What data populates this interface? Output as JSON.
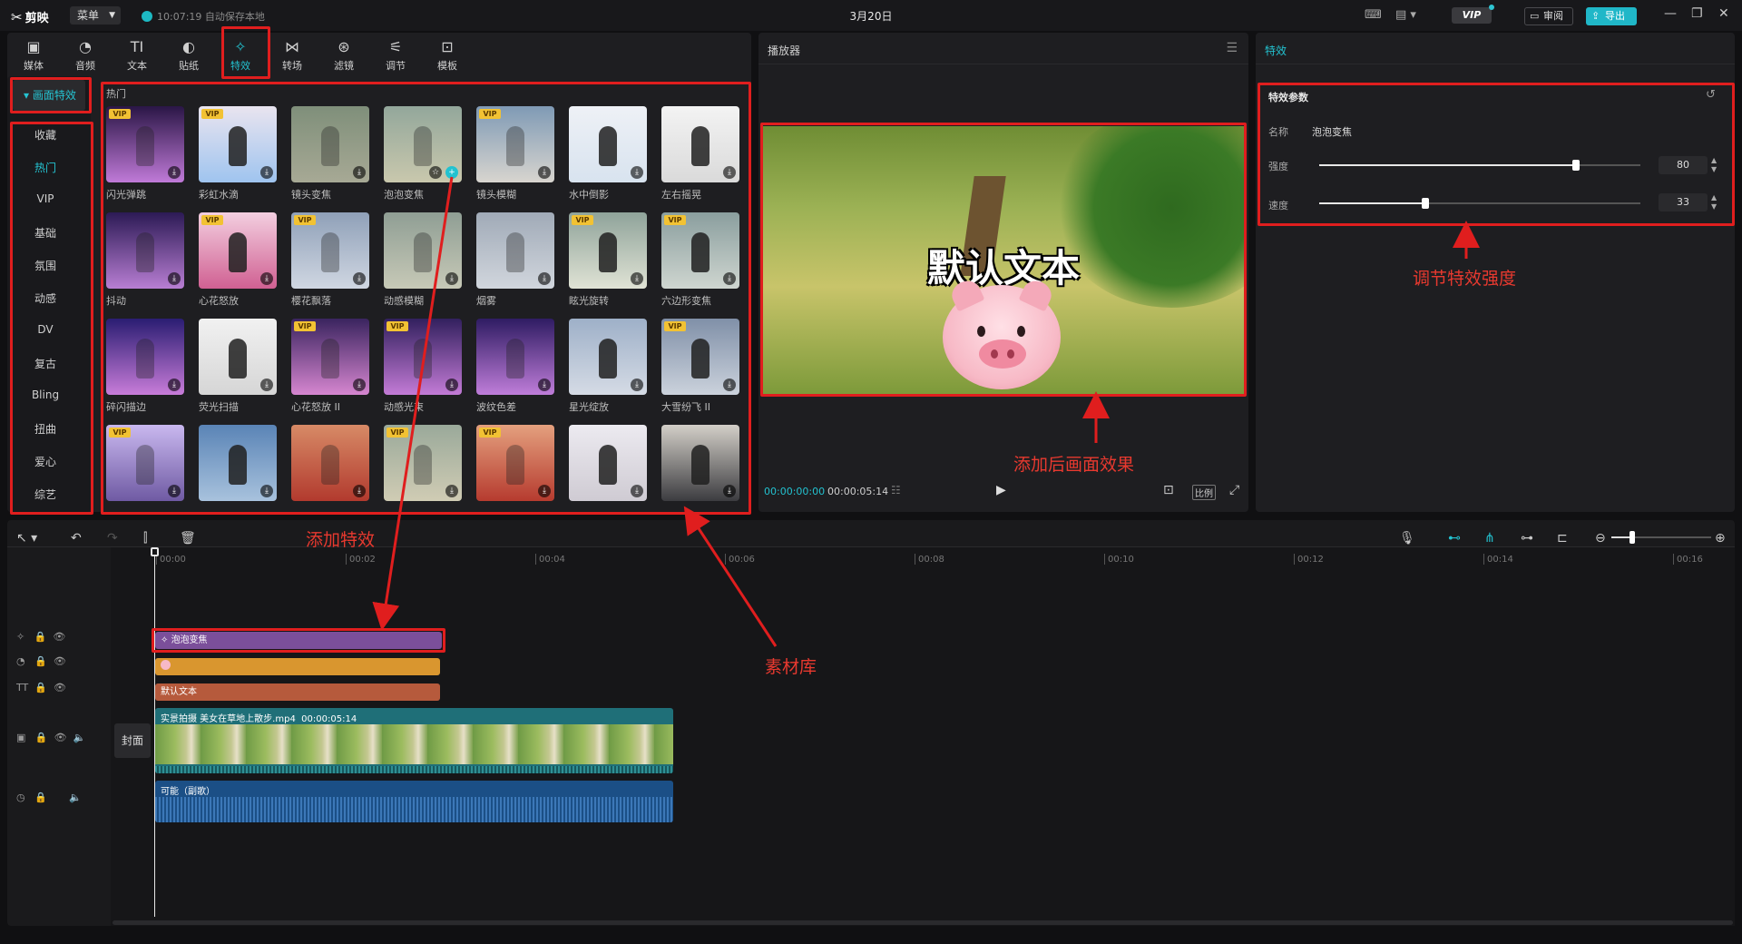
{
  "titlebar": {
    "app_name": "剪映",
    "menu_label": "菜单",
    "autosave_text": "10:07:19 自动保存本地",
    "project_title": "3月20日",
    "vip_label": "VIP",
    "review_label": "审阅",
    "export_label": "导出"
  },
  "toolbar": [
    {
      "label": "媒体",
      "icon": "media-icon",
      "glyph": "▣"
    },
    {
      "label": "音频",
      "icon": "audio-icon",
      "glyph": "◔"
    },
    {
      "label": "文本",
      "icon": "text-icon",
      "glyph": "TI"
    },
    {
      "label": "贴纸",
      "icon": "sticker-icon",
      "glyph": "◐"
    },
    {
      "label": "特效",
      "icon": "effects-icon",
      "glyph": "✧"
    },
    {
      "label": "转场",
      "icon": "transition-icon",
      "glyph": "⋈"
    },
    {
      "label": "滤镜",
      "icon": "filter-icon",
      "glyph": "⊛"
    },
    {
      "label": "调节",
      "icon": "adjust-icon",
      "glyph": "⚟"
    },
    {
      "label": "模板",
      "icon": "template-icon",
      "glyph": "⊡"
    }
  ],
  "categories": {
    "top_label": "▾ 画面特效",
    "items": [
      "收藏",
      "热门",
      "VIP",
      "基础",
      "氛围",
      "动感",
      "DV",
      "复古",
      "Bling",
      "扭曲",
      "爱心",
      "综艺"
    ],
    "active": "热门"
  },
  "effects_grid": {
    "section_title": "热门",
    "rows": [
      [
        {
          "name": "闪光弹跳",
          "vip": true,
          "colors": [
            "#2a1646",
            "#c07ad8"
          ]
        },
        {
          "name": "彩虹水滴",
          "vip": true,
          "colors": [
            "#e9e4ef",
            "#9fc4ef"
          ]
        },
        {
          "name": "镜头变焦",
          "vip": false,
          "colors": [
            "#7f8f7a",
            "#a7a995"
          ]
        },
        {
          "name": "泡泡变焦",
          "vip": false,
          "colors": [
            "#93a79b",
            "#c9c8ad"
          ]
        },
        {
          "name": "镜头模糊",
          "vip": true,
          "colors": [
            "#7f9ab5",
            "#d8d5cf"
          ]
        },
        {
          "name": "水中倒影",
          "vip": false,
          "colors": [
            "#eef1f6",
            "#d8e3ef"
          ]
        },
        {
          "name": "左右摇晃",
          "vip": false,
          "colors": [
            "#f3f3f3",
            "#dadada"
          ]
        }
      ],
      [
        {
          "name": "抖动",
          "vip": false,
          "colors": [
            "#2c1a55",
            "#b87ed3"
          ]
        },
        {
          "name": "心花怒放",
          "vip": true,
          "colors": [
            "#f3cfe0",
            "#d06092"
          ]
        },
        {
          "name": "樱花飘落",
          "vip": true,
          "colors": [
            "#8fa0b8",
            "#d0d7e2"
          ]
        },
        {
          "name": "动感模糊",
          "vip": false,
          "colors": [
            "#8f9e94",
            "#c7c9b7"
          ]
        },
        {
          "name": "烟雾",
          "vip": false,
          "colors": [
            "#a0aab7",
            "#d1d6dd"
          ]
        },
        {
          "name": "眩光旋转",
          "vip": true,
          "colors": [
            "#8fa39a",
            "#e0e3d5"
          ]
        },
        {
          "name": "六边形变焦",
          "vip": true,
          "colors": [
            "#8a9e9e",
            "#cfd6d0"
          ]
        }
      ],
      [
        {
          "name": "碎闪描边",
          "vip": false,
          "colors": [
            "#2a1d72",
            "#c87cd9"
          ]
        },
        {
          "name": "荧光扫描",
          "vip": false,
          "colors": [
            "#f1f1f1",
            "#d6d6d6"
          ]
        },
        {
          "name": "心花怒放 II",
          "vip": true,
          "colors": [
            "#3a245f",
            "#d686d0"
          ]
        },
        {
          "name": "动感光束",
          "vip": true,
          "colors": [
            "#32205e",
            "#c37bd6"
          ]
        },
        {
          "name": "波纹色差",
          "vip": false,
          "colors": [
            "#2f1c63",
            "#bf7dd9"
          ]
        },
        {
          "name": "星光绽放",
          "vip": false,
          "colors": [
            "#9eb0c8",
            "#d5dbe5"
          ]
        },
        {
          "name": "大雪纷飞 II",
          "vip": true,
          "colors": [
            "#8090a8",
            "#cbd2dc"
          ]
        }
      ],
      [
        {
          "name": "",
          "vip": true,
          "colors": [
            "#c9b8ef",
            "#6f5aa3"
          ]
        },
        {
          "name": "",
          "vip": false,
          "colors": [
            "#5a84b6",
            "#a8c2dd"
          ]
        },
        {
          "name": "",
          "vip": false,
          "colors": [
            "#d78a66",
            "#b23a2e"
          ]
        },
        {
          "name": "",
          "vip": true,
          "colors": [
            "#9aa99a",
            "#d0ccb4"
          ]
        },
        {
          "name": "",
          "vip": true,
          "colors": [
            "#e4a07e",
            "#b63b2f"
          ]
        },
        {
          "name": "",
          "vip": false,
          "colors": [
            "#eceaf0",
            "#cfcbd3"
          ]
        },
        {
          "name": "",
          "vip": false,
          "colors": [
            "#d3cfc8",
            "#3c3c40"
          ]
        }
      ]
    ]
  },
  "player": {
    "panel_title": "播放器",
    "overlay_text": "默认文本",
    "current_time": "00:00:00:00",
    "total_time": "00:00:05:14",
    "ratio_label": "比例"
  },
  "effect_params": {
    "panel_title": "特效",
    "section_title": "特效参数",
    "name_label": "名称",
    "name_value": "泡泡变焦",
    "strength_label": "强度",
    "strength_value": "80",
    "strength_level": 0.8,
    "speed_label": "速度",
    "speed_value": "33",
    "speed_level": 0.33
  },
  "timeline": {
    "ruler": [
      "00:00",
      "00:02",
      "00:04",
      "00:06",
      "00:08",
      "00:10",
      "00:12",
      "00:14",
      "00:16"
    ],
    "cover_label": "封面",
    "effect_clip": "泡泡变焦",
    "text_clip": "默认文本",
    "video_clip": "实景拍摄 美女在草地上散步.mp4",
    "video_duration": "00:00:05:14",
    "audio_clip": "可能（副歌）"
  },
  "annotations": {
    "add_effect": "添加特效",
    "after_effect": "添加后画面效果",
    "adjust_strength": "调节特效强度",
    "library": "素材库"
  },
  "colors": {
    "accent": "#23c2d0",
    "annotation_red": "#e01e1e",
    "effect_clip": "#7b4f9a",
    "sticker_clip": "#d9962f",
    "text_clip": "#b65a3c",
    "video_clip": "#1f6f78",
    "audio_clip": "#1b4f86"
  }
}
